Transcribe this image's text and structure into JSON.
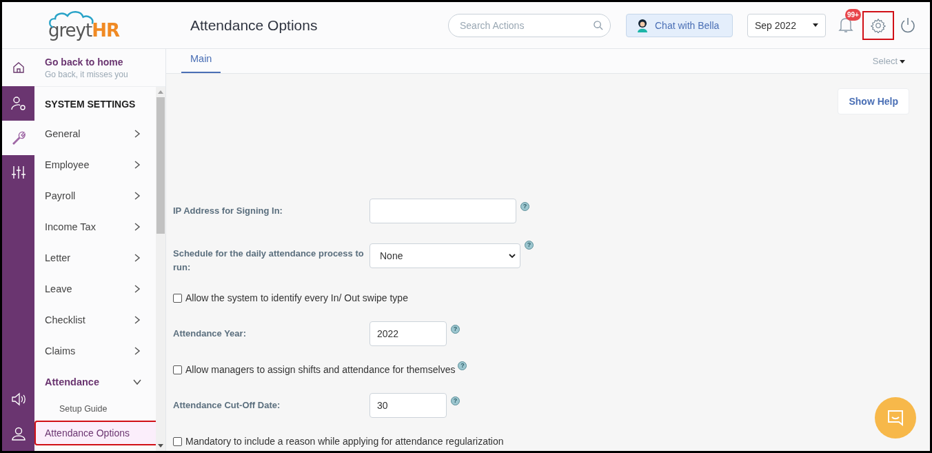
{
  "header": {
    "logo": {
      "text_1": "greyt",
      "text_2": "HR"
    },
    "title": "Attendance Options",
    "search": {
      "placeholder": "Search Actions"
    },
    "chat_button": "Chat with Bella",
    "month_select": {
      "value": "Sep 2022"
    },
    "notifications_badge": "99+",
    "settings_highlighted": true
  },
  "rail": [
    {
      "kind": "people-settings",
      "selected": false
    },
    {
      "kind": "wrench",
      "selected": true
    },
    {
      "kind": "sliders",
      "selected": false
    },
    {
      "kind": "speaker",
      "selected": false
    },
    {
      "kind": "person",
      "selected": false
    }
  ],
  "back_link": {
    "title": "Go back to home",
    "subtitle": "Go back, it misses you"
  },
  "sidebar": {
    "heading": "SYSTEM SETTINGS",
    "items": [
      {
        "label": "General",
        "expanded": false
      },
      {
        "label": "Employee",
        "expanded": false
      },
      {
        "label": "Payroll",
        "expanded": false
      },
      {
        "label": "Income Tax",
        "expanded": false
      },
      {
        "label": "Letter",
        "expanded": false
      },
      {
        "label": "Leave",
        "expanded": false
      },
      {
        "label": "Checklist",
        "expanded": false
      },
      {
        "label": "Claims",
        "expanded": false
      },
      {
        "label": "Attendance",
        "expanded": true,
        "children": [
          {
            "label": "Setup Guide",
            "selected": false,
            "highlighted": false
          },
          {
            "label": "Attendance Options",
            "selected": true,
            "highlighted": true
          }
        ]
      }
    ]
  },
  "tabs": [
    {
      "label": "Main",
      "selected": true
    }
  ],
  "view_select": "Select",
  "help_button": "Show Help",
  "form": [
    {
      "kind": "text",
      "label": "IP Address for Signing In:",
      "help": "?"
    },
    {
      "kind": "select",
      "label": "Schedule for the daily attendance process to run:",
      "value": "None",
      "help": "?"
    },
    {
      "kind": "checkbox",
      "label": "Allow the system to identify every In/ Out swipe type",
      "checked": false
    },
    {
      "kind": "number",
      "label": "Attendance Year:",
      "value": "2022",
      "help": "?"
    },
    {
      "kind": "checkbox",
      "label": "Allow managers to assign shifts and attendance for themselves",
      "checked": false,
      "help": "?"
    },
    {
      "kind": "number",
      "label": "Attendance Cut-Off Date:",
      "value": "30",
      "help": "?"
    },
    {
      "kind": "checkbox",
      "label": "Mandatory to include a reason while applying for attendance regularization",
      "checked": false
    }
  ]
}
